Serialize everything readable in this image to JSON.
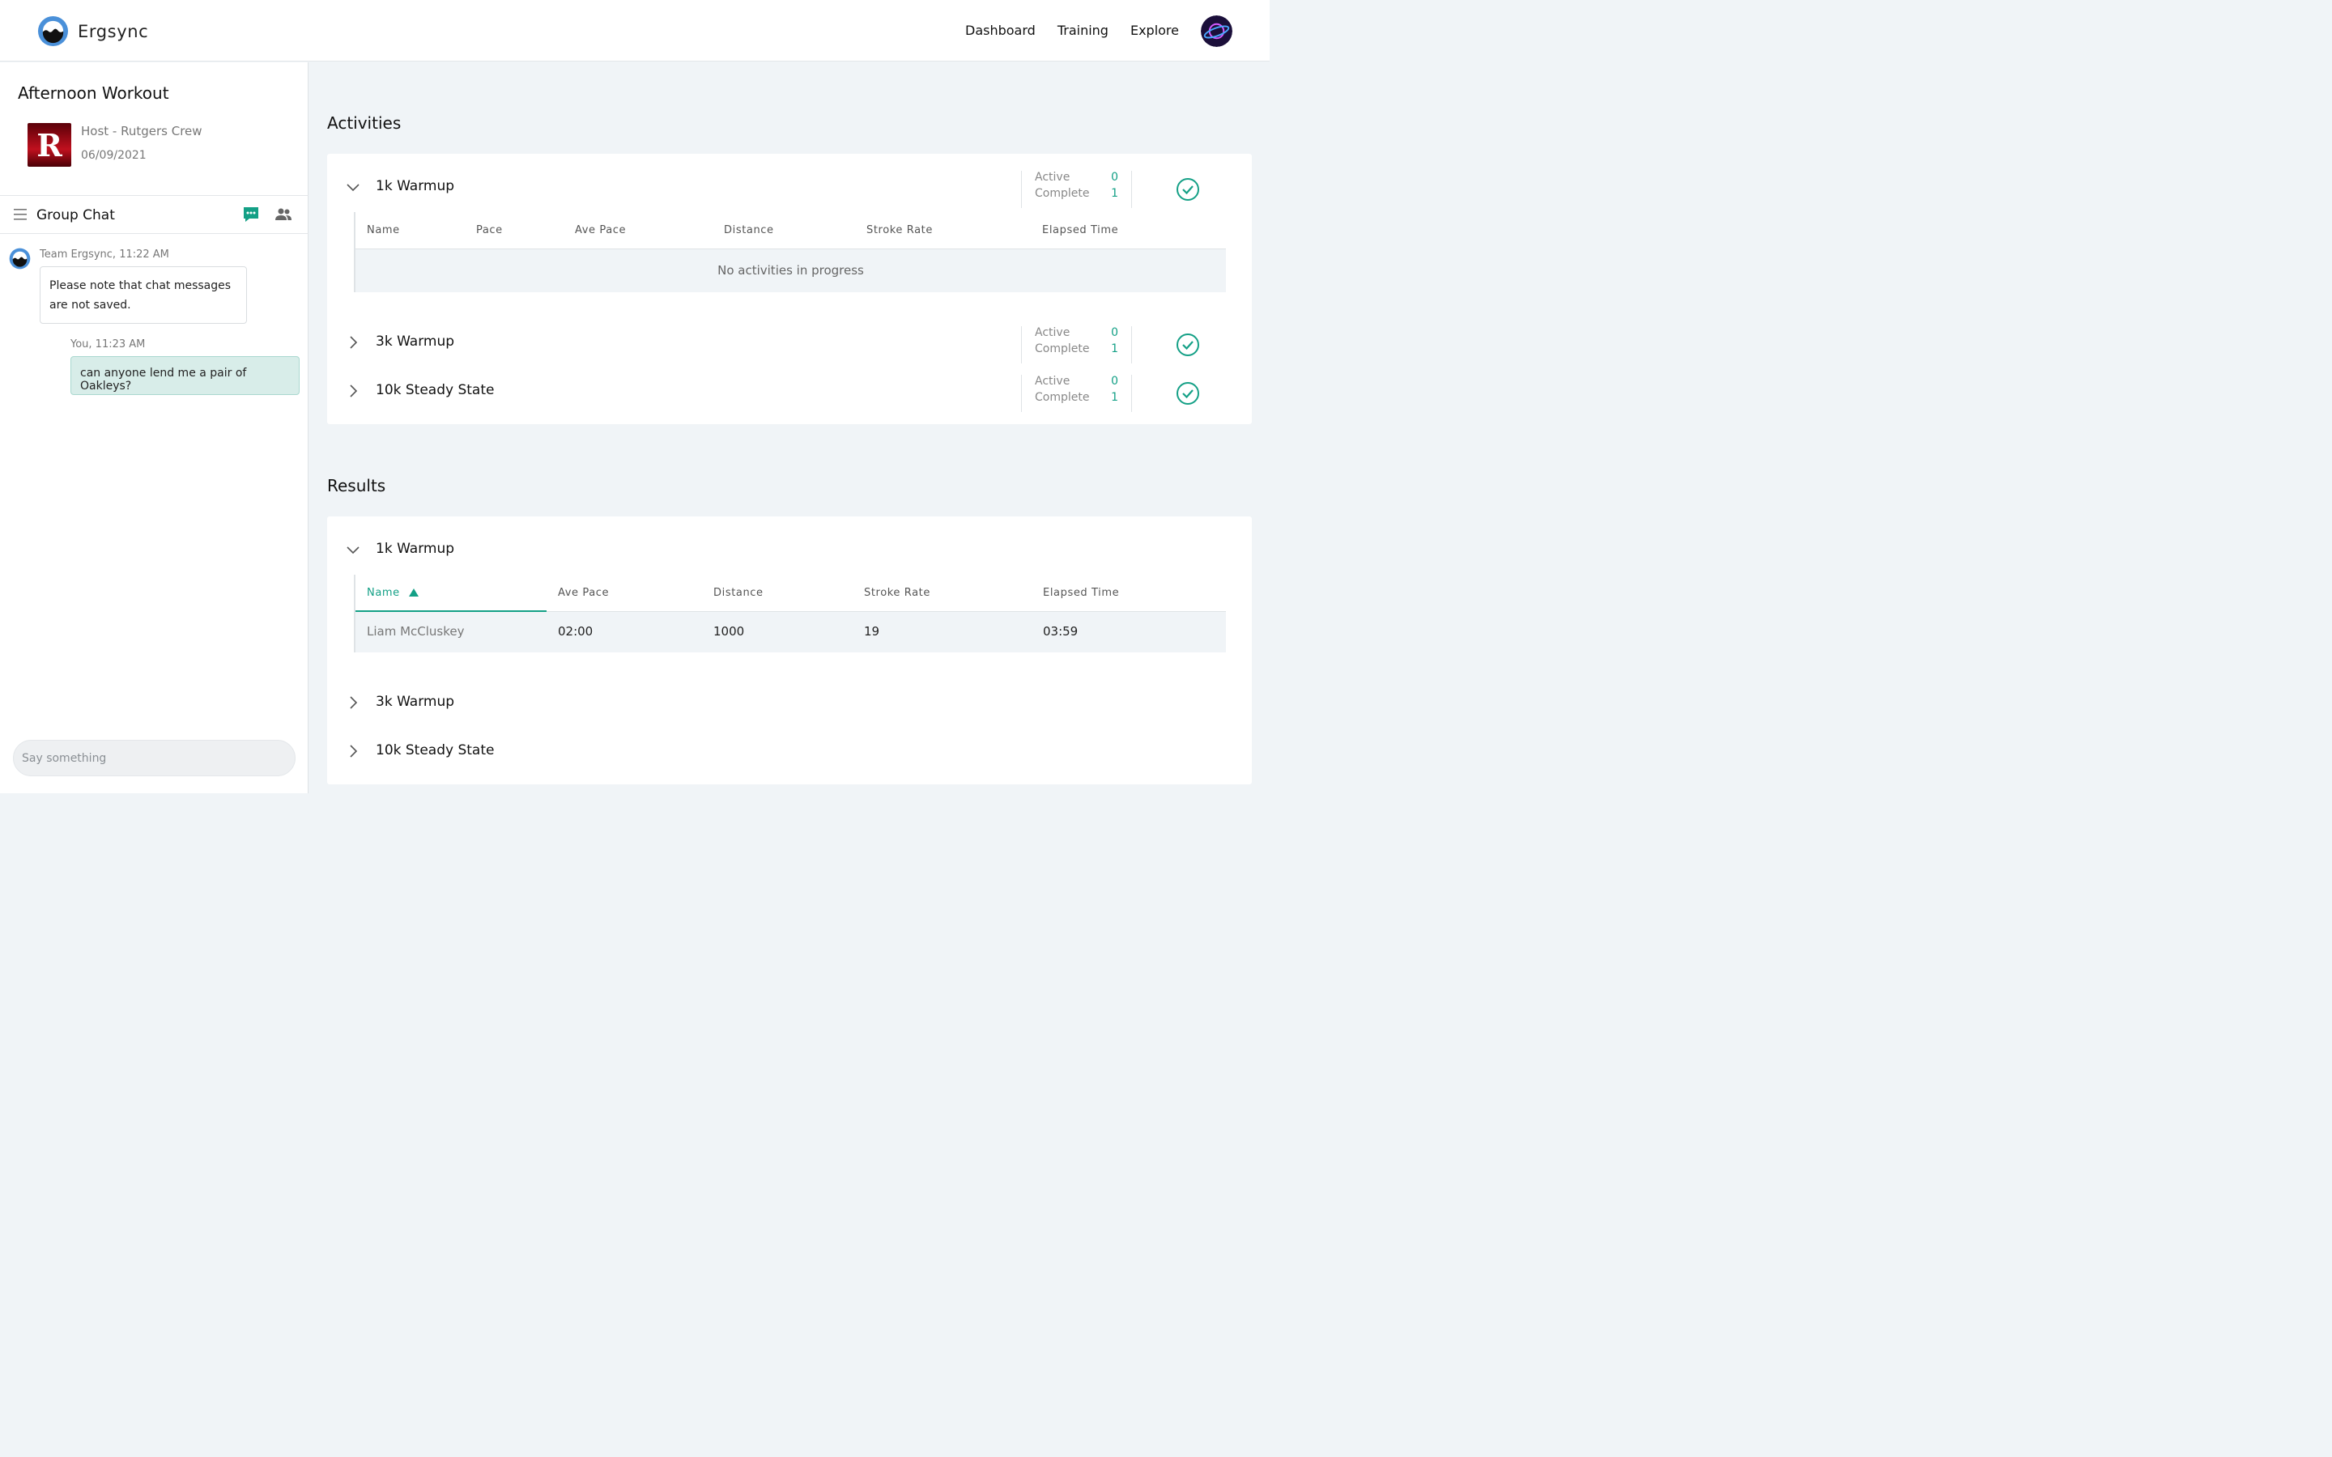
{
  "app": {
    "name": "Ergsync"
  },
  "nav": {
    "items": [
      "Dashboard",
      "Training",
      "Explore"
    ]
  },
  "workout": {
    "title": "Afternoon Workout",
    "host": "Host - Rutgers Crew",
    "date": "06/09/2021",
    "host_logo_letter": "R"
  },
  "chat": {
    "title": "Group Chat",
    "messages": [
      {
        "meta": "Team Ergsync, 11:22 AM",
        "text": "Please note that chat messages are not saved."
      },
      {
        "meta": "You, 11:23 AM",
        "text": "can anyone lend me a pair of Oakleys?"
      }
    ],
    "input_placeholder": "Say something"
  },
  "activities": {
    "title": "Activities",
    "rows": [
      {
        "name": "1k Warmup",
        "active_label": "Active",
        "active": "0",
        "complete_label": "Complete",
        "complete": "1",
        "expanded": true
      },
      {
        "name": "3k Warmup",
        "active_label": "Active",
        "active": "0",
        "complete_label": "Complete",
        "complete": "1",
        "expanded": false
      },
      {
        "name": "10k Steady State",
        "active_label": "Active",
        "active": "0",
        "complete_label": "Complete",
        "complete": "1",
        "expanded": false
      }
    ],
    "table_headers": [
      "Name",
      "Pace",
      "Ave Pace",
      "Distance",
      "Stroke Rate",
      "Elapsed Time"
    ],
    "empty_text": "No activities in progress"
  },
  "results": {
    "title": "Results",
    "rows": [
      {
        "name": "1k Warmup",
        "expanded": true
      },
      {
        "name": "3k Warmup",
        "expanded": false
      },
      {
        "name": "10k Steady State",
        "expanded": false
      }
    ],
    "table_headers": [
      "Name",
      "Ave Pace",
      "Distance",
      "Stroke Rate",
      "Elapsed Time"
    ],
    "sort_column": "Name",
    "data_rows": [
      {
        "name": "Liam McCluskey",
        "ave_pace": "02:00",
        "distance": "1000",
        "stroke_rate": "19",
        "elapsed_time": "03:59"
      }
    ]
  },
  "colors": {
    "accent": "#14a086",
    "brand_blue": "#4a90d9",
    "host_red": "#b00010"
  },
  "icons": [
    "ergsync-logo",
    "profile-planet-avatar",
    "menu-icon",
    "chat-bubble-icon",
    "people-icon",
    "chevron-down-icon",
    "chevron-right-icon",
    "check-circle-icon",
    "sort-ascending-icon"
  ]
}
